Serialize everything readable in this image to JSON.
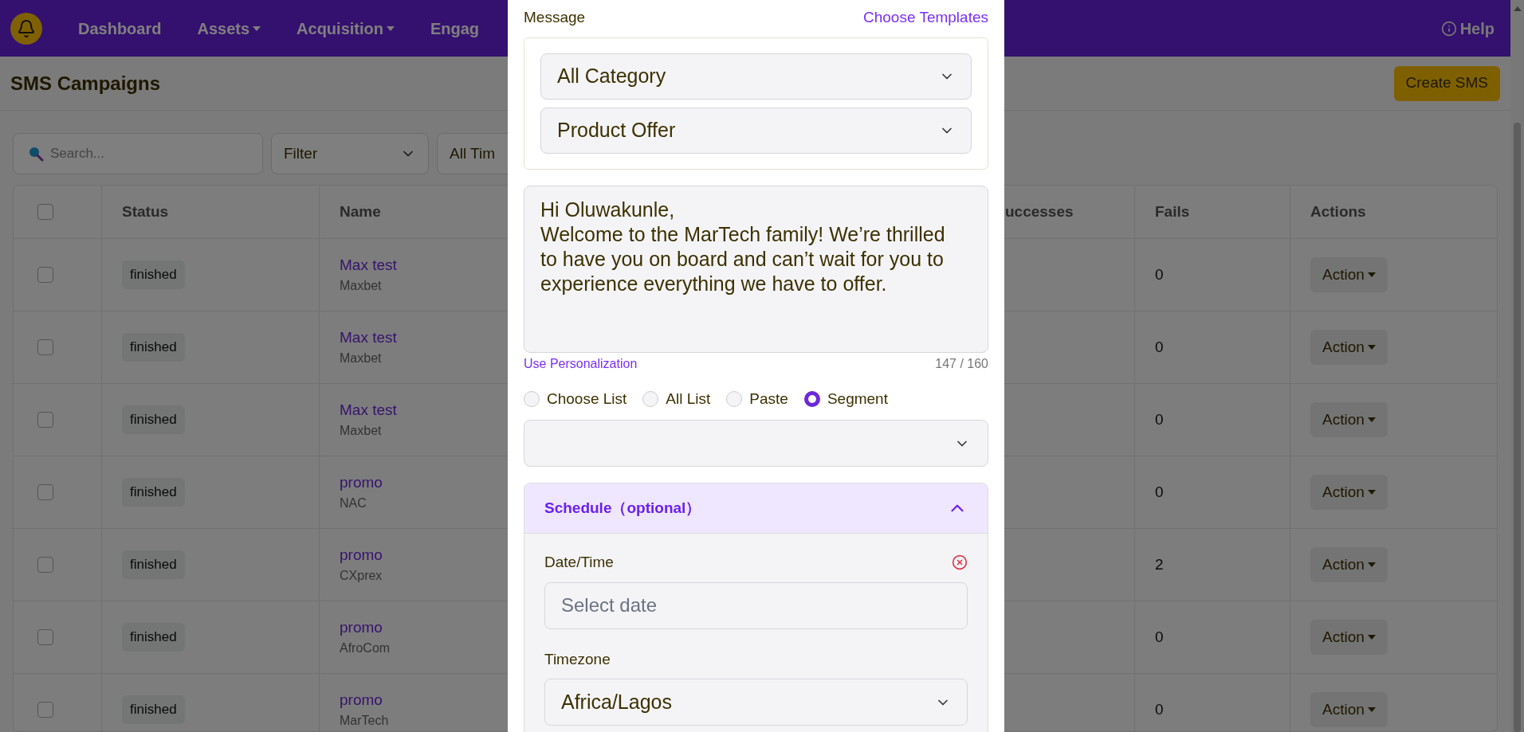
{
  "nav": {
    "items": [
      {
        "label": "Dashboard",
        "dropdown": false
      },
      {
        "label": "Assets",
        "dropdown": true
      },
      {
        "label": "Acquisition",
        "dropdown": true
      },
      {
        "label": "Engag",
        "dropdown": false
      }
    ],
    "help": "Help"
  },
  "page": {
    "title": "SMS Campaigns",
    "create_button": "Create SMS"
  },
  "filters": {
    "search_placeholder": "Search...",
    "filter": "Filter",
    "time": "All Tim"
  },
  "table": {
    "select_all_checked": false,
    "columns": [
      "Status",
      "Name",
      "uccesses",
      "Fails",
      "Actions"
    ],
    "rows": [
      {
        "checked": false,
        "status": "finished",
        "name": "Max test",
        "owner": "Maxbet",
        "fails": "0",
        "action": "Action"
      },
      {
        "checked": false,
        "status": "finished",
        "name": "Max test",
        "owner": "Maxbet",
        "fails": "0",
        "action": "Action"
      },
      {
        "checked": false,
        "status": "finished",
        "name": "Max test",
        "owner": "Maxbet",
        "fails": "0",
        "action": "Action"
      },
      {
        "checked": false,
        "status": "finished",
        "name": "promo",
        "owner": "NAC",
        "fails": "0",
        "action": "Action"
      },
      {
        "checked": false,
        "status": "finished",
        "name": "promo",
        "owner": "CXprex",
        "fails": "2",
        "action": "Action"
      },
      {
        "checked": false,
        "status": "finished",
        "name": "promo",
        "owner": "AfroCom",
        "fails": "0",
        "action": "Action"
      },
      {
        "checked": false,
        "status": "finished",
        "name": "promo",
        "owner": "MarTech",
        "fails": "0",
        "action": "Action"
      }
    ]
  },
  "modal": {
    "message_label": "Message",
    "templates_link": "Choose Templates",
    "category": "All Category",
    "template": "Product Offer",
    "message": "Hi Oluwakunle,\nWelcome to the MarTech family! We’re thrilled to have you on board and can’t wait for you to experience everything we have to offer.",
    "personalization_link": "Use Personalization",
    "counter": "147 / 160",
    "recipients": [
      {
        "label": "Choose List",
        "selected": false
      },
      {
        "label": "All List",
        "selected": false
      },
      {
        "label": "Paste",
        "selected": false
      },
      {
        "label": "Segment",
        "selected": true
      }
    ],
    "schedule": {
      "title": "Schedule（optional）",
      "expanded": true,
      "date_label": "Date/Time",
      "date_placeholder": "Select date",
      "timezone_label": "Timezone",
      "timezone": "Africa/Lagos"
    }
  }
}
